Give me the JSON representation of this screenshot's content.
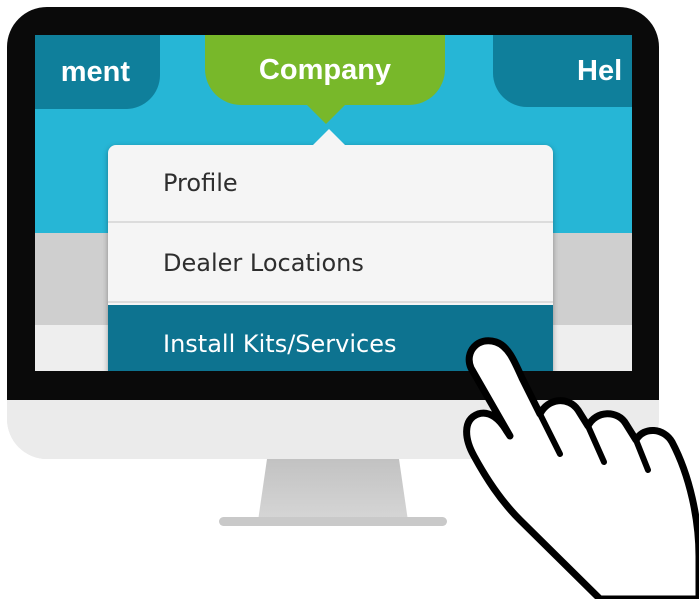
{
  "nav": {
    "left_tab_label": "ment",
    "active_tab_label": "Company",
    "right_tab_label": "Hel"
  },
  "dropdown": {
    "items": [
      {
        "label": "Profile",
        "active": false
      },
      {
        "label": "Dealer Locations",
        "active": false
      },
      {
        "label": "Install Kits/Services",
        "active": true
      }
    ]
  },
  "colors": {
    "nav_background": "#26b6d6",
    "active_tab": "#78b82a",
    "inactive_tab": "#0f7f9b",
    "selected_item": "#0d7390"
  },
  "icons": {
    "cursor": "pointing-hand-icon"
  }
}
